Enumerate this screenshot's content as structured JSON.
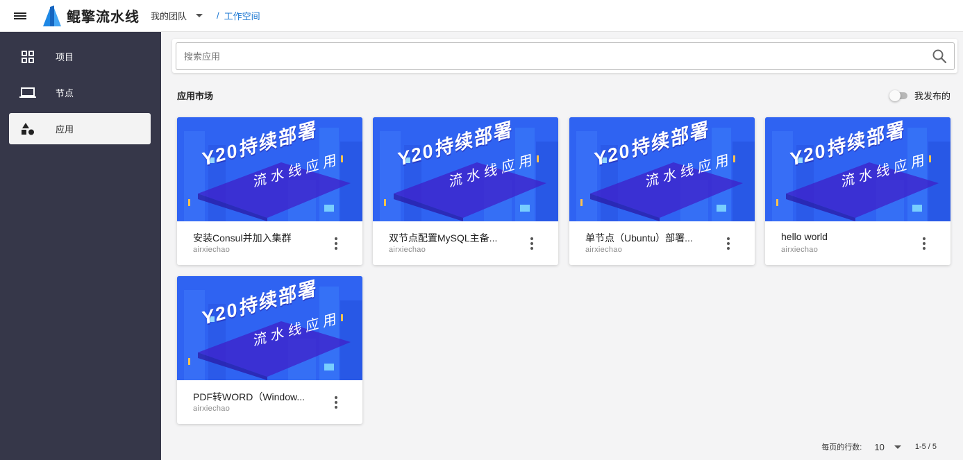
{
  "header": {
    "app_name": "鲲擎流水线",
    "team_label": "我的团队",
    "breadcrumb_sep": "/",
    "breadcrumb_current": "工作空间"
  },
  "sidebar": {
    "items": [
      {
        "label": "项目",
        "icon": "grid-icon",
        "active": false
      },
      {
        "label": "节点",
        "icon": "laptop-icon",
        "active": false
      },
      {
        "label": "应用",
        "icon": "shapes-icon",
        "active": true
      }
    ]
  },
  "search": {
    "placeholder": "搜索应用",
    "value": ""
  },
  "market": {
    "title": "应用市场",
    "toggle_label": "我发布的",
    "toggle_on": false
  },
  "banner": {
    "line1": "Y20持续部署",
    "line2": "流水线应用"
  },
  "apps": [
    {
      "title": "安装Consul并加入集群",
      "author": "airxiechao"
    },
    {
      "title": "双节点配置MySQL主备...",
      "author": "airxiechao"
    },
    {
      "title": "单节点（Ubuntu）部署...",
      "author": "airxiechao"
    },
    {
      "title": "hello world",
      "author": "airxiechao"
    },
    {
      "title": "PDF转WORD（Window...",
      "author": "airxiechao"
    }
  ],
  "pagination": {
    "rows_label": "每页的行数:",
    "rows_value": "10",
    "range": "1-5 / 5"
  },
  "colors": {
    "sidebar_bg": "#363749",
    "accent": "#1976d2",
    "banner_blue": "#2b5ff0"
  }
}
